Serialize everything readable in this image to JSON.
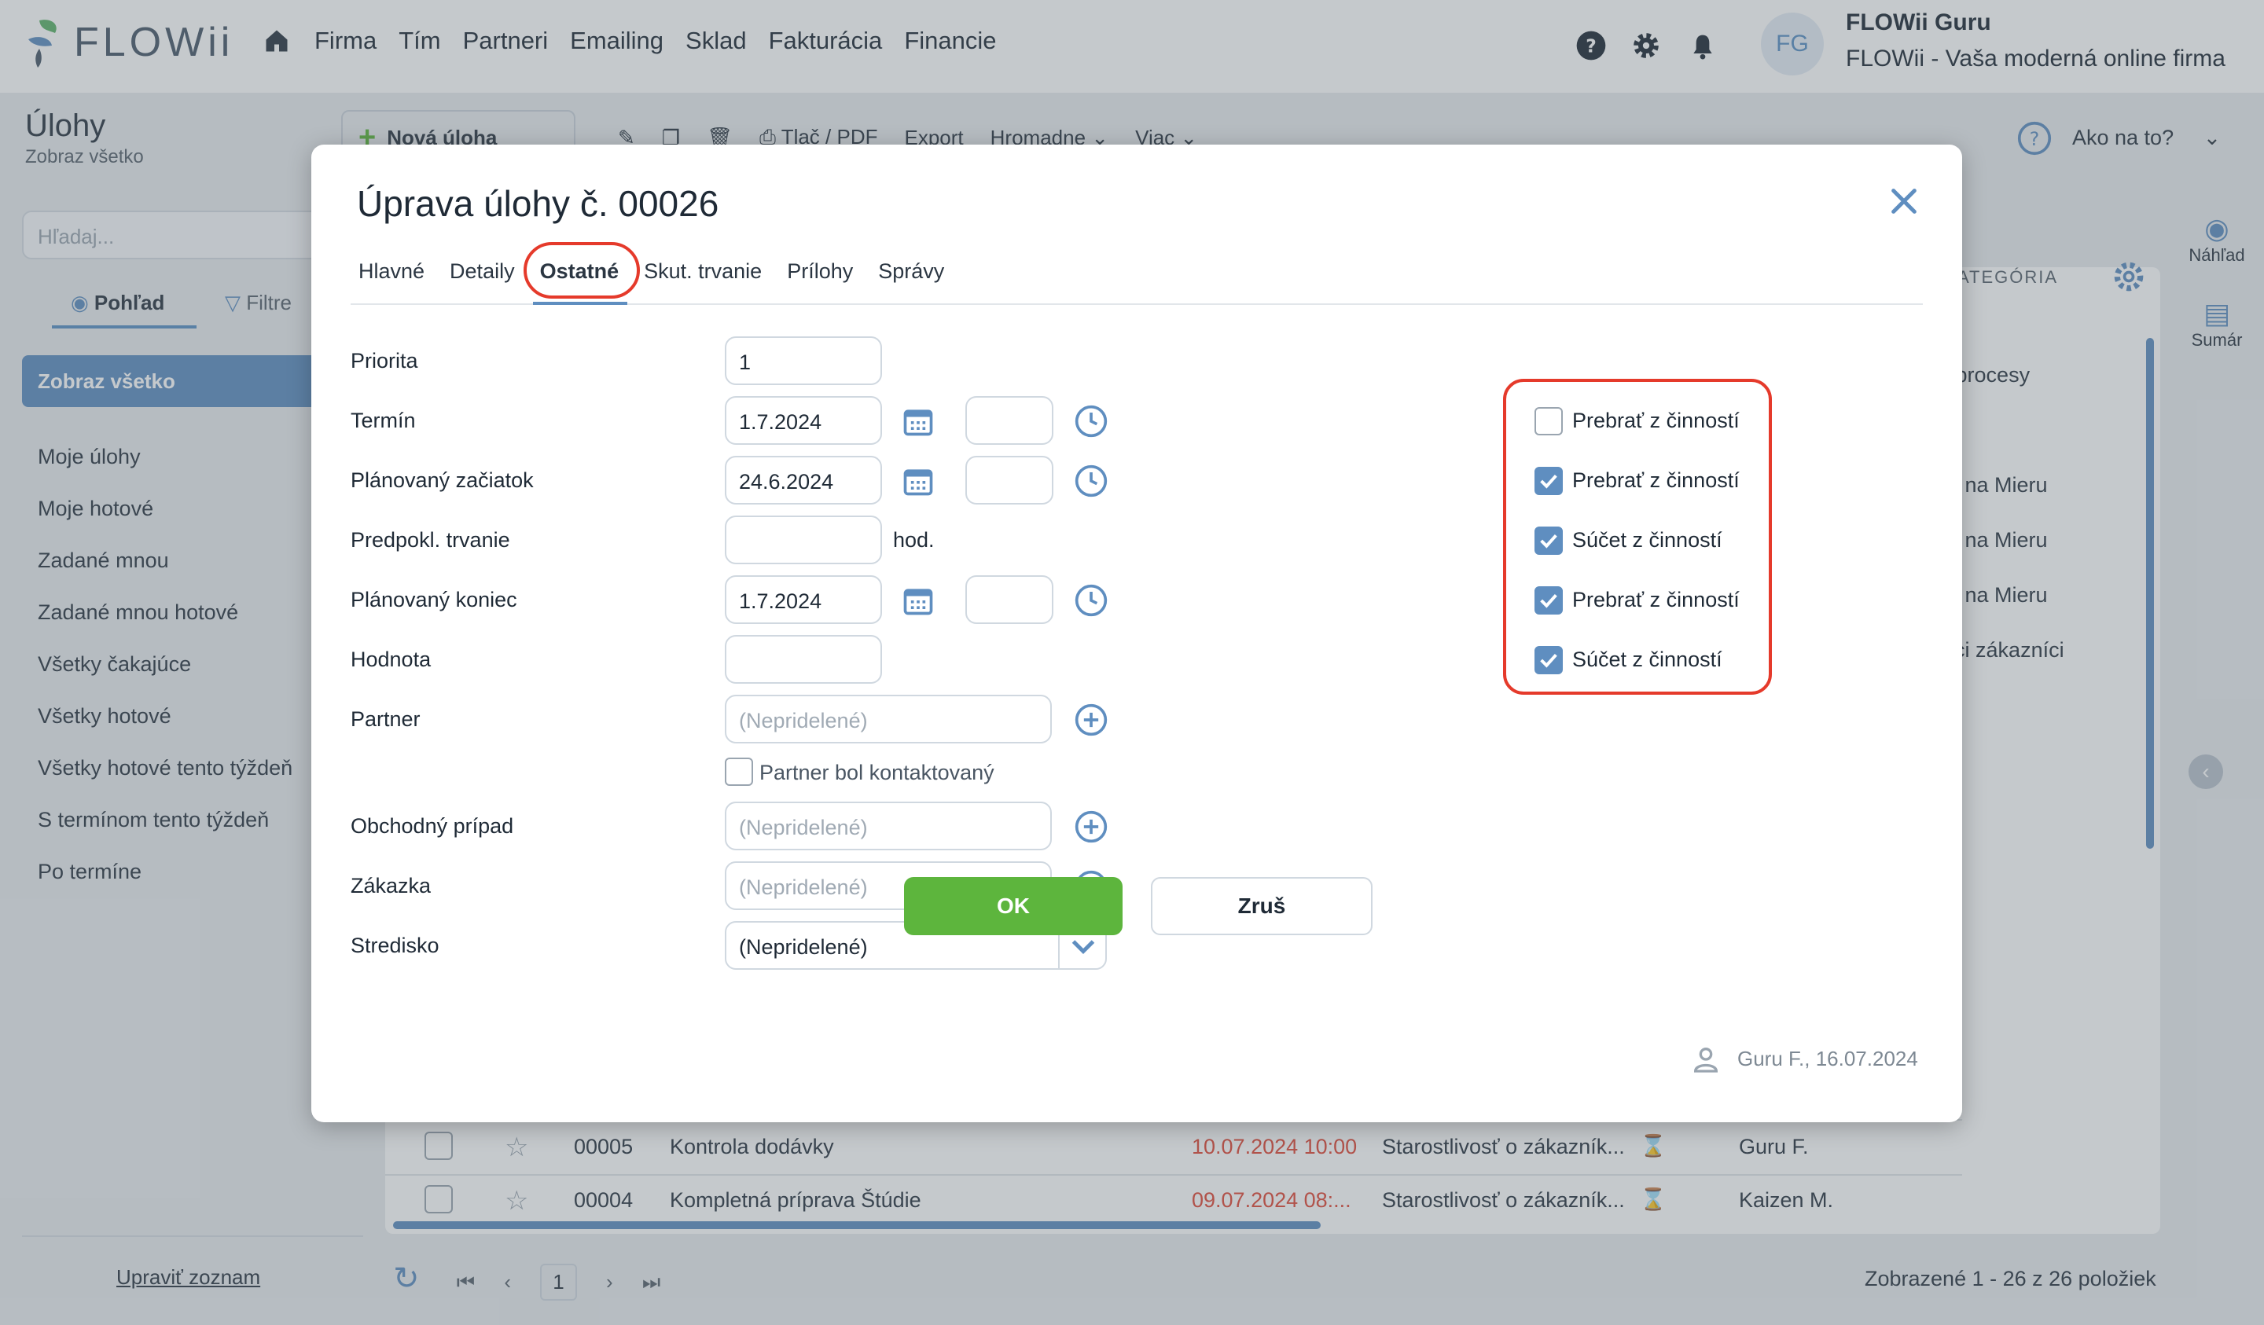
{
  "app": {
    "logo_text": "FLOWii",
    "nav": [
      "Firma",
      "Tím",
      "Partneri",
      "Emailing",
      "Sklad",
      "Fakturácia",
      "Financie"
    ],
    "avatar_initials": "FG",
    "user_name": "FLOWii Guru",
    "user_firm": "FLOWii - Vaša moderná online firma",
    "accent": "#5f8ec0"
  },
  "page": {
    "title": "Úlohy",
    "subtitle": "Zobraz všetko",
    "toolbar": {
      "new_task": "Nová úloha",
      "print": "Tlač / PDF",
      "export": "Export",
      "bulk": "Hromadne",
      "more": "Viac"
    },
    "howto": "Ako na to?",
    "search_placeholder": "Hľadaj...",
    "view_tab": "Pohľad",
    "filter_tab": "Filtre",
    "sidebar_active": "Zobraz všetko",
    "sidebar_items": [
      "Moje úlohy",
      "Moje hotové",
      "Zadané mnou",
      "Zadané mnou hotové",
      "Všetky čakajúce",
      "Všetky hotové",
      "Všetky hotové tento týždeň",
      "S termínom tento týždeň",
      "Po termíne"
    ],
    "edit_list": "Upraviť zoznam",
    "category_header": "ATEGÓRIA",
    "category_cells": [
      "né procesy",
      "zka na Mieru",
      "zka na Mieru",
      "zka na Mieru",
      "ujúci zákazníci"
    ],
    "rows": [
      {
        "id": "00005",
        "name": "Kontrola dodávky",
        "date": "10.07.2024 10:00",
        "cat": "Starostlivosť o zákazník...",
        "owner": "Guru F."
      },
      {
        "id": "00004",
        "name": "Kompletná príprava Štúdie",
        "date": "09.07.2024 08:...",
        "cat": "Starostlivosť o zákazník...",
        "owner": "Kaizen M."
      }
    ],
    "page_num": "1",
    "count": "Zobrazené 1 - 26 z 26 položiek",
    "right_panel": [
      "Náhľad",
      "Sumár"
    ]
  },
  "modal": {
    "title": "Úprava úlohy č. 00026",
    "tabs": [
      "Hlavné",
      "Detaily",
      "Ostatné",
      "Skut. trvanie",
      "Prílohy",
      "Správy"
    ],
    "active_tab": "Ostatné",
    "fields": {
      "priority_label": "Priorita",
      "priority_value": "1",
      "deadline_label": "Termín",
      "deadline_value": "1.7.2024",
      "planned_start_label": "Plánovaný začiatok",
      "planned_start_value": "24.6.2024",
      "est_duration_label": "Predpokl. trvanie",
      "est_duration_unit": "hod.",
      "planned_end_label": "Plánovaný koniec",
      "planned_end_value": "1.7.2024",
      "value_label": "Hodnota",
      "partner_label": "Partner",
      "partner_placeholder": "(Nepridelené)",
      "partner_contacted_label": "Partner bol kontaktovaný",
      "deal_label": "Obchodný prípad",
      "deal_placeholder": "(Nepridelené)",
      "order_label": "Zákazka",
      "order_placeholder": "(Nepridelené)",
      "center_label": "Stredisko",
      "center_value": "(Nepridelené)"
    },
    "checkboxes": [
      {
        "label": "Prebrať z činností",
        "checked": false
      },
      {
        "label": "Prebrať z činností",
        "checked": true
      },
      {
        "label": "Súčet z činností",
        "checked": true
      },
      {
        "label": "Prebrať z činností",
        "checked": true
      },
      {
        "label": "Súčet z činností",
        "checked": true
      }
    ],
    "ok": "OK",
    "cancel": "Zruš",
    "author": "Guru F., 16.07.2024",
    "highlight_color": "#e53a2b",
    "ok_color": "#5db53d"
  }
}
